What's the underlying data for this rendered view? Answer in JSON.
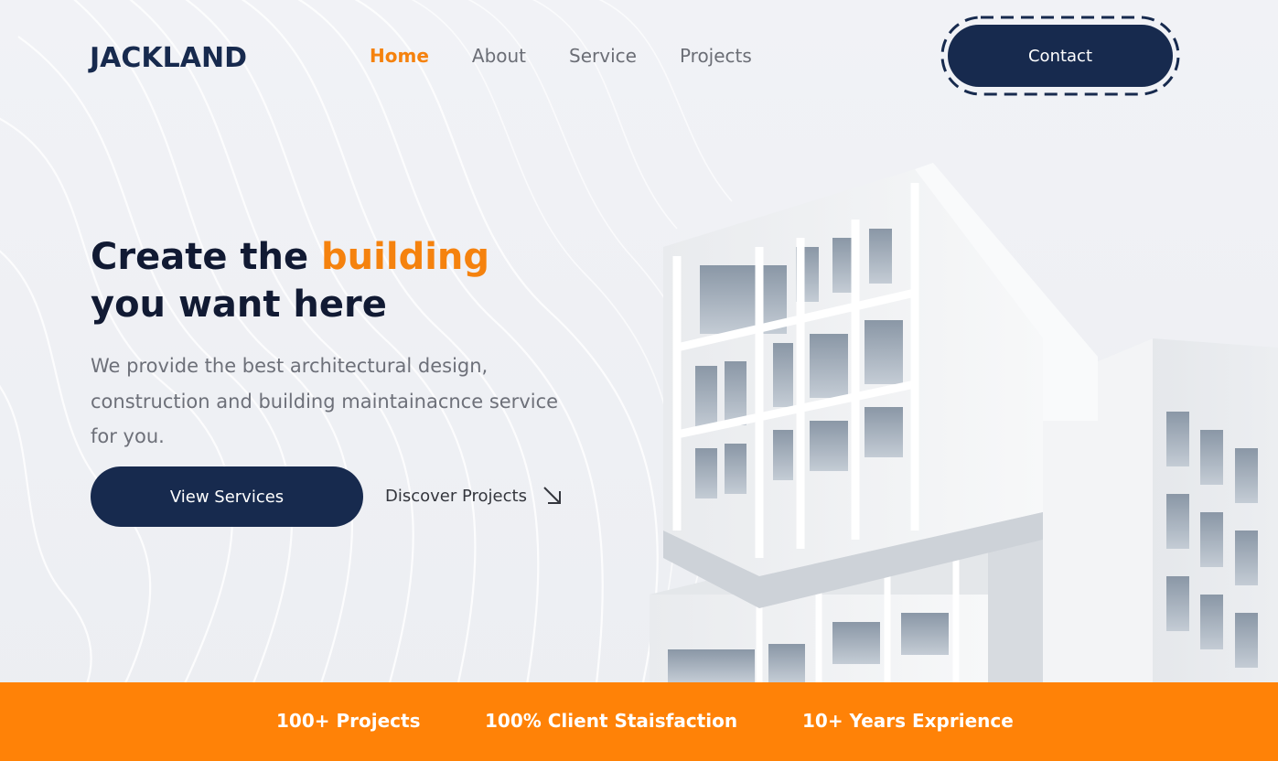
{
  "brand": {
    "logo_text": "JACKLAND"
  },
  "nav": {
    "items": [
      {
        "label": "Home",
        "active": true
      },
      {
        "label": "About",
        "active": false
      },
      {
        "label": "Service",
        "active": false
      },
      {
        "label": "Projects",
        "active": false
      }
    ],
    "contact_label": "Contact"
  },
  "hero": {
    "title_part1": "Create the ",
    "title_accent": "building",
    "title_part2": "you want here",
    "description": "We provide the best architectural design, construction and building maintainacnce service for you.",
    "primary_button": "View Services",
    "secondary_link": "Discover Projects"
  },
  "stats": [
    {
      "label": "100+ Projects"
    },
    {
      "label": "100% Client Staisfaction"
    },
    {
      "label": "10+ Years Exprience"
    }
  ],
  "colors": {
    "accent": "#f5820e",
    "navy": "#172a4e",
    "stats_bar": "#ff8207",
    "background": "#eef0f4"
  },
  "icons": {
    "discover_arrow": "arrow-down-right-icon"
  }
}
